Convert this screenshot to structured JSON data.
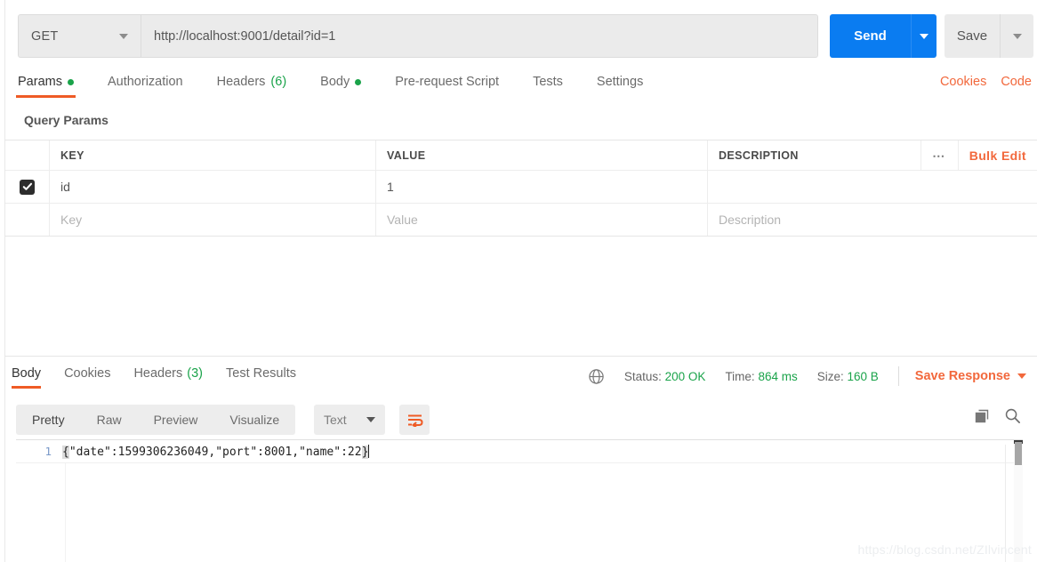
{
  "request": {
    "method": "GET",
    "url": "http://localhost:9001/detail?id=1",
    "send_label": "Send",
    "save_label": "Save",
    "tabs": [
      {
        "label": "Params",
        "indicator": "dot",
        "active": true
      },
      {
        "label": "Authorization",
        "indicator": "none",
        "active": false
      },
      {
        "label": "Headers",
        "indicator": "count",
        "count": "(6)",
        "active": false
      },
      {
        "label": "Body",
        "indicator": "dot",
        "active": false
      },
      {
        "label": "Pre-request Script",
        "indicator": "none",
        "active": false
      },
      {
        "label": "Tests",
        "indicator": "none",
        "active": false
      },
      {
        "label": "Settings",
        "indicator": "none",
        "active": false
      }
    ],
    "links": [
      {
        "label": "Cookies"
      },
      {
        "label": "Code"
      }
    ]
  },
  "query_params": {
    "section_title": "Query Params",
    "columns": [
      "KEY",
      "VALUE",
      "DESCRIPTION"
    ],
    "bulk_edit_label": "Bulk Edit",
    "rows": [
      {
        "checked": true,
        "key": "id",
        "value": "1",
        "description": ""
      }
    ],
    "new_row": {
      "key_placeholder": "Key",
      "value_placeholder": "Value",
      "description_placeholder": "Description"
    }
  },
  "response": {
    "tabs": [
      {
        "label": "Body",
        "indicator": "none",
        "active": true
      },
      {
        "label": "Cookies",
        "indicator": "none",
        "active": false
      },
      {
        "label": "Headers",
        "indicator": "count",
        "count": "(3)",
        "active": false
      },
      {
        "label": "Test Results",
        "indicator": "none",
        "active": false
      }
    ],
    "status_label": "Status:",
    "status_value": "200 OK",
    "time_label": "Time:",
    "time_value": "864 ms",
    "size_label": "Size:",
    "size_value": "160 B",
    "save_response_label": "Save Response",
    "format_tabs": [
      {
        "label": "Pretty",
        "active": true
      },
      {
        "label": "Raw",
        "active": false
      },
      {
        "label": "Preview",
        "active": false
      },
      {
        "label": "Visualize",
        "active": false
      }
    ],
    "type_selected": "Text",
    "body_lines": [
      {
        "number": "1",
        "text": "{\"date\":1599306236049,\"port\":8001,\"name\":22}"
      }
    ],
    "body_open_brace": "{",
    "body_middle": "\"date\":1599306236049,\"port\":8001,\"name\":22",
    "body_close_brace": "}"
  },
  "watermark": "https://blog.csdn.net/ZIlvincent",
  "colors": {
    "accent_orange": "#ef5b25",
    "link_orange": "#f2683c",
    "send_blue": "#0a7cf1",
    "status_green": "#1aa34a"
  }
}
